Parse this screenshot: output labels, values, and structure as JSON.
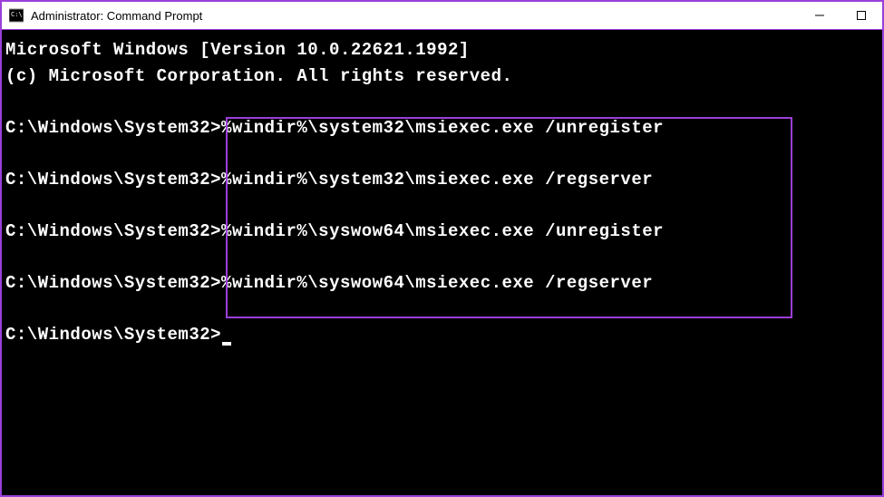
{
  "window": {
    "title": "Administrator: Command Prompt"
  },
  "terminal": {
    "header_version": "Microsoft Windows [Version 10.0.22621.1992]",
    "header_copyright": "(c) Microsoft Corporation. All rights reserved.",
    "prompt": "C:\\Windows\\System32>",
    "lines": [
      {
        "prompt": "C:\\Windows\\System32>",
        "command": "%windir%\\system32\\msiexec.exe /unregister"
      },
      {
        "prompt": "C:\\Windows\\System32>",
        "command": "%windir%\\system32\\msiexec.exe /regserver"
      },
      {
        "prompt": "C:\\Windows\\System32>",
        "command": "%windir%\\syswow64\\msiexec.exe /unregister"
      },
      {
        "prompt": "C:\\Windows\\System32>",
        "command": "%windir%\\syswow64\\msiexec.exe /regserver"
      }
    ]
  }
}
